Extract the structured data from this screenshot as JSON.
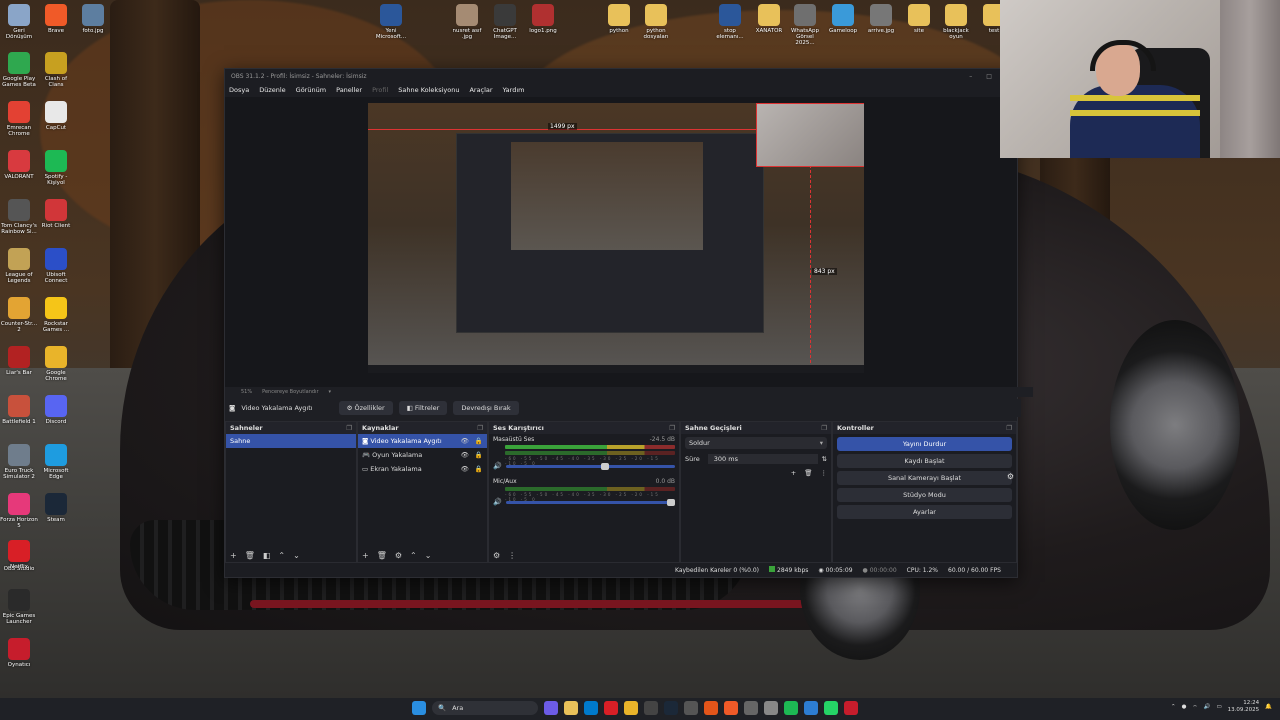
{
  "desktop": {
    "left_icons": [
      {
        "label": "Geri Dönüşüm",
        "color": "#8aa5c8"
      },
      {
        "label": "Brave",
        "color": "#f05a28"
      },
      {
        "label": "foto.jpg",
        "color": "#5d7ea0"
      },
      {
        "label": "Google Play Games Beta",
        "color": "#2fa84f"
      },
      {
        "label": "Clash of Clans",
        "color": "#c7a020"
      },
      {
        "label": "Emrecan Chrome",
        "color": "#e34133"
      },
      {
        "label": "CapCut",
        "color": "#e8e8e8"
      },
      {
        "label": "VALORANT",
        "color": "#d83a3f"
      },
      {
        "label": "Spotify - Kişiyol",
        "color": "#1db954"
      },
      {
        "label": "Tom Clancy's Rainbow Si...",
        "color": "#555555"
      },
      {
        "label": "Riot Client",
        "color": "#d13639"
      },
      {
        "label": "League of Legends",
        "color": "#c2a255"
      },
      {
        "label": "Ubisoft Connect",
        "color": "#2b4fc8"
      },
      {
        "label": "Counter-Str... 2",
        "color": "#e3a433"
      },
      {
        "label": "Rockstar Games ...",
        "color": "#f5c518"
      },
      {
        "label": "Liar's Bar",
        "color": "#b22222"
      },
      {
        "label": "Google Chrome",
        "color": "#e9b42a"
      },
      {
        "label": "Battlefield 1",
        "color": "#c8513c"
      },
      {
        "label": "Discord",
        "color": "#5865f2"
      },
      {
        "label": "Euro Truck Simulator 2",
        "color": "#6f7d8c"
      },
      {
        "label": "Microsoft Edge",
        "color": "#1e9ce0"
      },
      {
        "label": "Forza Horizon 5",
        "color": "#e6397a"
      },
      {
        "label": "Steam",
        "color": "#1b2838"
      },
      {
        "label": "OBS Studio",
        "color": "#302e31"
      },
      {
        "label": "Netflix",
        "color": "#d81f26"
      },
      {
        "label": "Epic Games Launcher",
        "color": "#2a2a2a"
      },
      {
        "label": "Oynatıcı",
        "color": "#c61d2c"
      }
    ],
    "top_icons": [
      {
        "label": "Yeni Microsoft...",
        "color": "#2b579a"
      },
      {
        "label": "nusret asıf .jpg",
        "color": "#a58b73"
      },
      {
        "label": "ChatGPT Image...",
        "color": "#3a3a3a"
      },
      {
        "label": "logo1.png",
        "color": "#b03030"
      },
      {
        "label": "python",
        "color": "#e8c15a"
      },
      {
        "label": "python dosyaları",
        "color": "#e8c15a"
      },
      {
        "label": "stop elemanı...",
        "color": "#2b579a"
      },
      {
        "label": "XANATOR",
        "color": "#e8c15a"
      },
      {
        "label": "WhatsApp Görsel 2025...",
        "color": "#6f6f6f"
      },
      {
        "label": "Gameloop",
        "color": "#3a9ad9"
      },
      {
        "label": "arrive.jpg",
        "color": "#777777"
      },
      {
        "label": "site",
        "color": "#e8c15a"
      },
      {
        "label": "blackjack oyun",
        "color": "#e8c15a"
      },
      {
        "label": "test",
        "color": "#e8c15a"
      }
    ]
  },
  "obs": {
    "title": "OBS 31.1.2 - Profil: İsimsiz - Sahneler: İsimsiz",
    "menu": [
      "Dosya",
      "Düzenle",
      "Görünüm",
      "Paneller",
      "Profil",
      "Sahne Koleksiyonu",
      "Araçlar",
      "Yardım"
    ],
    "preview": {
      "width_label": "1499 px",
      "height_label": "843 px",
      "zoom_label": "51%",
      "fit_label": "Pencereye Boyutlandır"
    },
    "source_bar": {
      "selected": "Video Yakalama Aygıtı",
      "properties": "Özellikler",
      "filters": "Filtreler",
      "deactivate": "Devredışı Bırak"
    },
    "scenes": {
      "title": "Sahneler",
      "items": [
        "Sahne"
      ]
    },
    "sources": {
      "title": "Kaynaklar",
      "items": [
        "Video Yakalama Aygıtı",
        "Oyun Yakalama",
        "Ekran Yakalama"
      ]
    },
    "mixer": {
      "title": "Ses Karıştırıcı",
      "channels": [
        {
          "name": "Masaüstü Ses",
          "db": "-24.5 dB",
          "level": 0.62
        },
        {
          "name": "Mic/Aux",
          "db": "0.0 dB",
          "level": 0.0
        }
      ],
      "ticks": "-60 -55 -50 -45 -40 -35 -30 -25 -20 -15 -10 -5 0"
    },
    "transitions": {
      "title": "Sahne Geçişleri",
      "selected": "Soldur",
      "duration_label": "Süre",
      "duration_value": "300 ms"
    },
    "controls": {
      "title": "Kontroller",
      "buttons": [
        "Yayını Durdur",
        "Kaydı Başlat",
        "Sanal Kamerayı Başlat",
        "Stüdyo Modu",
        "Ayarlar"
      ]
    },
    "status": {
      "dropped": "Kaybedilen Kareler 0 (%0.0)",
      "bitrate": "2849 kbps",
      "stream_time": "00:05:09",
      "rec_time": "00:00:00",
      "cpu": "CPU: 1.2%",
      "fps": "60.00 / 60.00 FPS"
    }
  },
  "taskbar": {
    "search_placeholder": "Ara",
    "time": "12:24",
    "date": "13.09.2025"
  }
}
